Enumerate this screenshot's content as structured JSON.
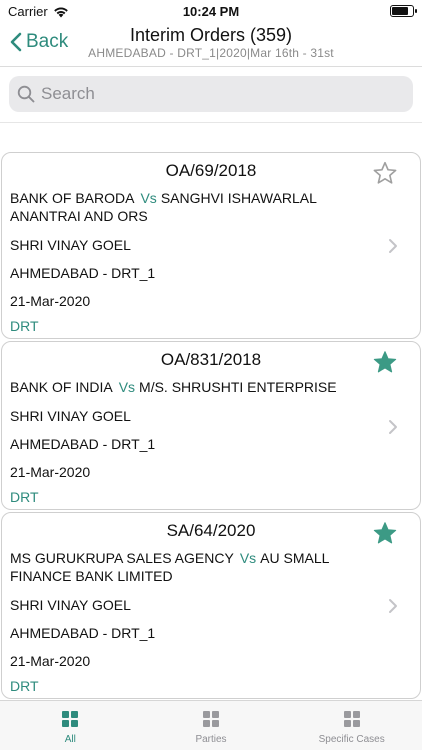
{
  "status_bar": {
    "carrier": "Carrier",
    "time": "10:24 PM"
  },
  "nav": {
    "back_label": "Back",
    "title": "Interim Orders  (359)",
    "subtitle": "AHMEDABAD - DRT_1|2020|Mar 16th - 31st"
  },
  "search": {
    "placeholder": "Search"
  },
  "vs_label": "Vs",
  "cases": [
    {
      "case_no": "OA/69/2018",
      "starred": false,
      "petitioner": "BANK OF BARODA",
      "respondent": "SANGHVI ISHAWARLAL ANANTRAI AND ORS",
      "officer": "SHRI VINAY GOEL",
      "bench": "AHMEDABAD - DRT_1",
      "date": "21-Mar-2020",
      "tribunal": "DRT"
    },
    {
      "case_no": "OA/831/2018",
      "starred": true,
      "petitioner": "BANK OF INDIA",
      "respondent": "M/S. SHRUSHTI ENTERPRISE",
      "officer": "SHRI VINAY GOEL",
      "bench": "AHMEDABAD - DRT_1",
      "date": "21-Mar-2020",
      "tribunal": "DRT"
    },
    {
      "case_no": "SA/64/2020",
      "starred": true,
      "petitioner": "MS GURUKRUPA SALES AGENCY",
      "respondent": "AU SMALL FINANCE BANK LIMITED",
      "officer": "SHRI VINAY GOEL",
      "bench": "AHMEDABAD - DRT_1",
      "date": "21-Mar-2020",
      "tribunal": "DRT"
    }
  ],
  "tabs": [
    {
      "label": "All",
      "active": true,
      "icon": "grid-icon"
    },
    {
      "label": "Parties",
      "active": false,
      "icon": "grid-icon"
    },
    {
      "label": "Specific Cases",
      "active": false,
      "icon": "grid-icon"
    }
  ],
  "colors": {
    "accent": "#2e8b7d",
    "inactive": "#8e8e93",
    "star_filled": "#3c9a85",
    "star_empty": "#a0a0a0"
  }
}
